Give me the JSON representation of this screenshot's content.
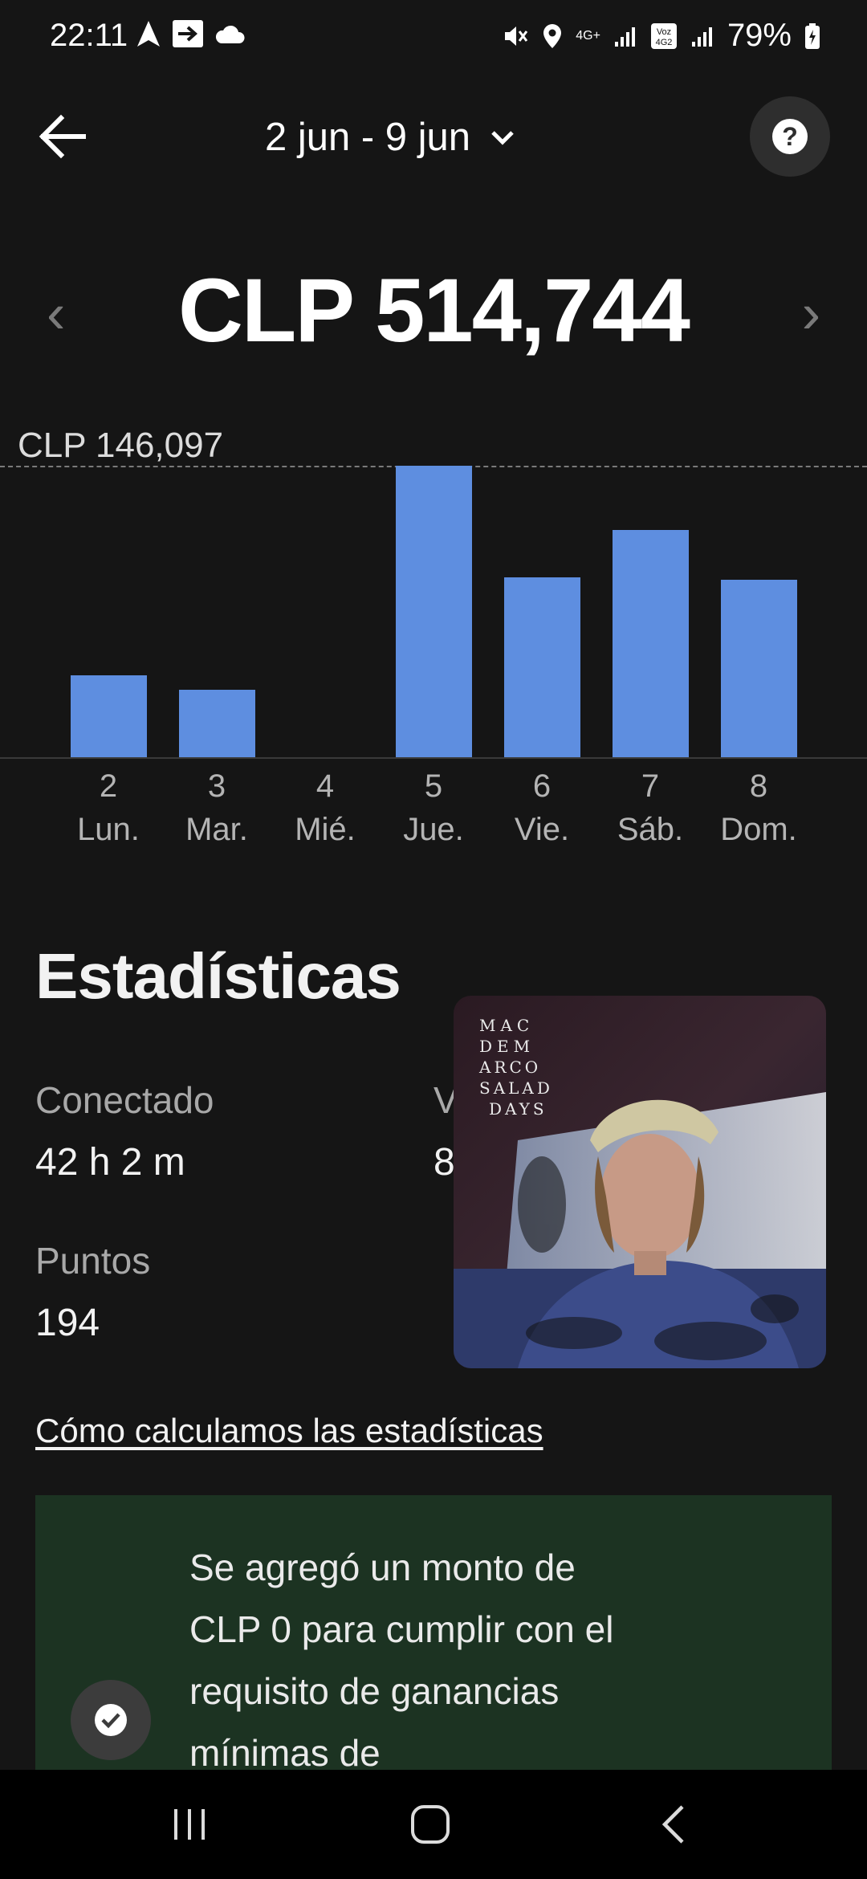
{
  "status_bar": {
    "time": "22:11",
    "signal_label": "4G+",
    "voz_label": "Voz 4G2",
    "battery": "79%"
  },
  "header": {
    "date_range": "2 jun - 9 jun",
    "help_icon": "?"
  },
  "earnings": {
    "total": "CLP 514,744",
    "prev_icon": "‹",
    "next_icon": "›"
  },
  "chart_data": {
    "type": "bar",
    "max_label": "CLP 146,097",
    "ylim": [
      0,
      146097
    ],
    "categories": [
      {
        "num": "2",
        "day": "Lun."
      },
      {
        "num": "3",
        "day": "Mar."
      },
      {
        "num": "4",
        "day": "Mié."
      },
      {
        "num": "5",
        "day": "Jue."
      },
      {
        "num": "6",
        "day": "Vie."
      },
      {
        "num": "7",
        "day": "Sáb."
      },
      {
        "num": "8",
        "day": "Dom."
      }
    ],
    "values": [
      41000,
      34000,
      0,
      146097,
      90000,
      114000,
      89000
    ],
    "bar_color": "#5e8ee0"
  },
  "stats": {
    "title": "Estadísticas",
    "connected_label": "Conectado",
    "connected_value": "42 h 2 m",
    "second_label_partial": "V",
    "second_value_partial": "8",
    "points_label": "Puntos",
    "points_value": "194",
    "link": "Cómo calculamos las estadísticas"
  },
  "album": {
    "text_lines": [
      "MAC",
      "DEM",
      "ARCO",
      "SALAD",
      "DAYS"
    ]
  },
  "banner": {
    "text": "Se agregó un monto de CLP 0 para cumplir con el requisito de ganancias mínimas de",
    "bg_color": "#1c3322"
  }
}
